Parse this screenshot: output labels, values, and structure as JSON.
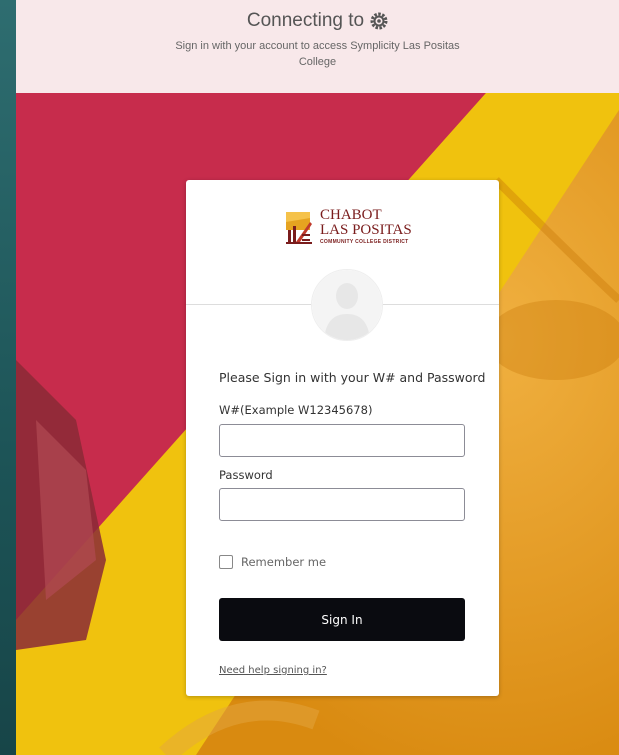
{
  "banner": {
    "title": "Connecting to",
    "title_icon": "gear-icon",
    "subtitle": "Sign in with your account to access Symplicity Las Positas College"
  },
  "logo": {
    "line1": "CHABOT",
    "line2": "LAS POSITAS",
    "line3": "COMMUNITY COLLEGE DISTRICT",
    "icon": "college-logo-icon"
  },
  "form": {
    "prompt": "Please Sign in with your W# and Password",
    "username_label": "W#(Example W12345678)",
    "username_value": "",
    "password_label": "Password",
    "password_value": "",
    "remember_label": "Remember me",
    "remember_checked": false,
    "signin_label": "Sign In",
    "help_link": "Need help signing in?"
  },
  "colors": {
    "banner_bg": "#f8e8ea",
    "background_pink": "#c72c4c",
    "background_yellow": "#f0c20e",
    "background_orange": "#e8a21a",
    "button_bg": "#0a0b10",
    "side_strip": "#1f5a5e",
    "logo_color": "#7a1c1c"
  }
}
